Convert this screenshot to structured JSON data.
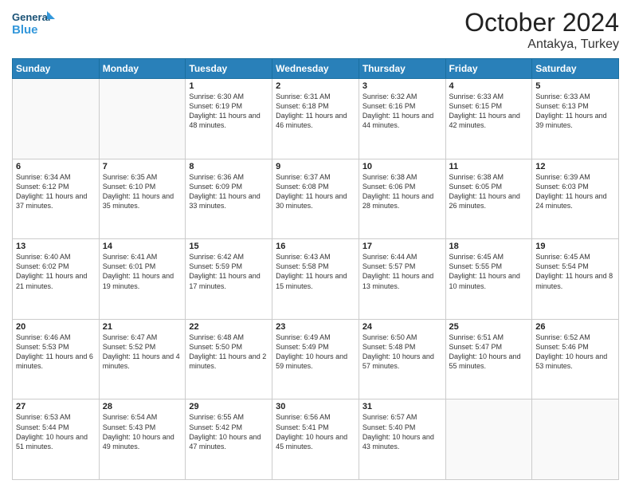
{
  "header": {
    "logo_line1": "General",
    "logo_line2": "Blue",
    "month_year": "October 2024",
    "subtitle": "Antakya, Turkey"
  },
  "days_of_week": [
    "Sunday",
    "Monday",
    "Tuesday",
    "Wednesday",
    "Thursday",
    "Friday",
    "Saturday"
  ],
  "weeks": [
    [
      {
        "day": "",
        "info": ""
      },
      {
        "day": "",
        "info": ""
      },
      {
        "day": "1",
        "info": "Sunrise: 6:30 AM\nSunset: 6:19 PM\nDaylight: 11 hours and 48 minutes."
      },
      {
        "day": "2",
        "info": "Sunrise: 6:31 AM\nSunset: 6:18 PM\nDaylight: 11 hours and 46 minutes."
      },
      {
        "day": "3",
        "info": "Sunrise: 6:32 AM\nSunset: 6:16 PM\nDaylight: 11 hours and 44 minutes."
      },
      {
        "day": "4",
        "info": "Sunrise: 6:33 AM\nSunset: 6:15 PM\nDaylight: 11 hours and 42 minutes."
      },
      {
        "day": "5",
        "info": "Sunrise: 6:33 AM\nSunset: 6:13 PM\nDaylight: 11 hours and 39 minutes."
      }
    ],
    [
      {
        "day": "6",
        "info": "Sunrise: 6:34 AM\nSunset: 6:12 PM\nDaylight: 11 hours and 37 minutes."
      },
      {
        "day": "7",
        "info": "Sunrise: 6:35 AM\nSunset: 6:10 PM\nDaylight: 11 hours and 35 minutes."
      },
      {
        "day": "8",
        "info": "Sunrise: 6:36 AM\nSunset: 6:09 PM\nDaylight: 11 hours and 33 minutes."
      },
      {
        "day": "9",
        "info": "Sunrise: 6:37 AM\nSunset: 6:08 PM\nDaylight: 11 hours and 30 minutes."
      },
      {
        "day": "10",
        "info": "Sunrise: 6:38 AM\nSunset: 6:06 PM\nDaylight: 11 hours and 28 minutes."
      },
      {
        "day": "11",
        "info": "Sunrise: 6:38 AM\nSunset: 6:05 PM\nDaylight: 11 hours and 26 minutes."
      },
      {
        "day": "12",
        "info": "Sunrise: 6:39 AM\nSunset: 6:03 PM\nDaylight: 11 hours and 24 minutes."
      }
    ],
    [
      {
        "day": "13",
        "info": "Sunrise: 6:40 AM\nSunset: 6:02 PM\nDaylight: 11 hours and 21 minutes."
      },
      {
        "day": "14",
        "info": "Sunrise: 6:41 AM\nSunset: 6:01 PM\nDaylight: 11 hours and 19 minutes."
      },
      {
        "day": "15",
        "info": "Sunrise: 6:42 AM\nSunset: 5:59 PM\nDaylight: 11 hours and 17 minutes."
      },
      {
        "day": "16",
        "info": "Sunrise: 6:43 AM\nSunset: 5:58 PM\nDaylight: 11 hours and 15 minutes."
      },
      {
        "day": "17",
        "info": "Sunrise: 6:44 AM\nSunset: 5:57 PM\nDaylight: 11 hours and 13 minutes."
      },
      {
        "day": "18",
        "info": "Sunrise: 6:45 AM\nSunset: 5:55 PM\nDaylight: 11 hours and 10 minutes."
      },
      {
        "day": "19",
        "info": "Sunrise: 6:45 AM\nSunset: 5:54 PM\nDaylight: 11 hours and 8 minutes."
      }
    ],
    [
      {
        "day": "20",
        "info": "Sunrise: 6:46 AM\nSunset: 5:53 PM\nDaylight: 11 hours and 6 minutes."
      },
      {
        "day": "21",
        "info": "Sunrise: 6:47 AM\nSunset: 5:52 PM\nDaylight: 11 hours and 4 minutes."
      },
      {
        "day": "22",
        "info": "Sunrise: 6:48 AM\nSunset: 5:50 PM\nDaylight: 11 hours and 2 minutes."
      },
      {
        "day": "23",
        "info": "Sunrise: 6:49 AM\nSunset: 5:49 PM\nDaylight: 10 hours and 59 minutes."
      },
      {
        "day": "24",
        "info": "Sunrise: 6:50 AM\nSunset: 5:48 PM\nDaylight: 10 hours and 57 minutes."
      },
      {
        "day": "25",
        "info": "Sunrise: 6:51 AM\nSunset: 5:47 PM\nDaylight: 10 hours and 55 minutes."
      },
      {
        "day": "26",
        "info": "Sunrise: 6:52 AM\nSunset: 5:46 PM\nDaylight: 10 hours and 53 minutes."
      }
    ],
    [
      {
        "day": "27",
        "info": "Sunrise: 6:53 AM\nSunset: 5:44 PM\nDaylight: 10 hours and 51 minutes."
      },
      {
        "day": "28",
        "info": "Sunrise: 6:54 AM\nSunset: 5:43 PM\nDaylight: 10 hours and 49 minutes."
      },
      {
        "day": "29",
        "info": "Sunrise: 6:55 AM\nSunset: 5:42 PM\nDaylight: 10 hours and 47 minutes."
      },
      {
        "day": "30",
        "info": "Sunrise: 6:56 AM\nSunset: 5:41 PM\nDaylight: 10 hours and 45 minutes."
      },
      {
        "day": "31",
        "info": "Sunrise: 6:57 AM\nSunset: 5:40 PM\nDaylight: 10 hours and 43 minutes."
      },
      {
        "day": "",
        "info": ""
      },
      {
        "day": "",
        "info": ""
      }
    ]
  ]
}
